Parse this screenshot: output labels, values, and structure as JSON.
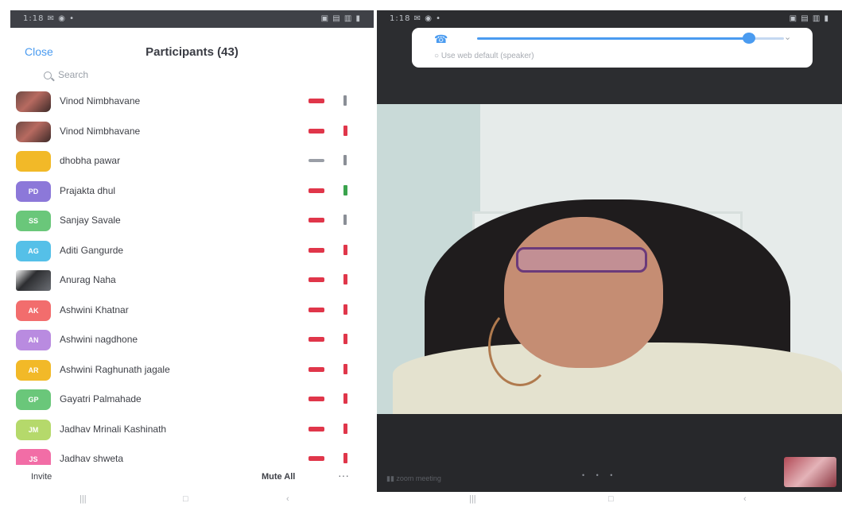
{
  "left_phone": {
    "status_left": "1:18 ✉ ◉ •",
    "status_right": "▣ ▤ ▥ ▮",
    "header": {
      "close_label": "Close",
      "title": "Participants (43)"
    },
    "search": {
      "placeholder": "Search"
    },
    "participants": [
      {
        "initials": "",
        "avatar_color": "photo",
        "name": "Vinod Nimbhavane",
        "sub": "",
        "mic": "muted",
        "cam": "grey"
      },
      {
        "initials": "",
        "avatar_color": "photo",
        "name": "Vinod Nimbhavane",
        "sub": "",
        "mic": "muted",
        "cam": "red"
      },
      {
        "initials": "",
        "avatar_color": "#f2b928",
        "name": "dhobha pawar",
        "sub": "",
        "mic": "off",
        "cam": "grey"
      },
      {
        "initials": "PD",
        "avatar_color": "#8c78d9",
        "name": "Prajakta dhul",
        "sub": "",
        "mic": "muted",
        "cam": "green"
      },
      {
        "initials": "SS",
        "avatar_color": "#6ac77a",
        "name": "Sanjay Savale",
        "sub": "",
        "mic": "muted",
        "cam": "grey"
      },
      {
        "initials": "AG",
        "avatar_color": "#55c0e8",
        "name": "Aditi Gangurde",
        "sub": "",
        "mic": "muted",
        "cam": "red"
      },
      {
        "initials": "",
        "avatar_color": "photo2",
        "name": "Anurag Naha",
        "sub": "",
        "mic": "muted",
        "cam": "red"
      },
      {
        "initials": "AK",
        "avatar_color": "#f26d6d",
        "name": "Ashwini Khatnar",
        "sub": "",
        "mic": "muted",
        "cam": "red"
      },
      {
        "initials": "AN",
        "avatar_color": "#b98be0",
        "name": "Ashwini nagdhone",
        "sub": "",
        "mic": "muted",
        "cam": "red"
      },
      {
        "initials": "AR",
        "avatar_color": "#f2b928",
        "name": "Ashwini Raghunath jagale",
        "sub": "",
        "mic": "muted",
        "cam": "red"
      },
      {
        "initials": "GP",
        "avatar_color": "#6ac77a",
        "name": "Gayatri Palmahade",
        "sub": "",
        "mic": "muted",
        "cam": "red"
      },
      {
        "initials": "JM",
        "avatar_color": "#b5d96b",
        "name": "Jadhav Mrinali Kashinath",
        "sub": "",
        "mic": "muted",
        "cam": "red"
      },
      {
        "initials": "JS",
        "avatar_color": "#f26da6",
        "name": "Jadhav shweta",
        "sub": "",
        "mic": "muted",
        "cam": "red"
      }
    ],
    "footer": {
      "invite_label": "Invite",
      "mute_all_label": "Mute All",
      "more_label": "···"
    }
  },
  "right_phone": {
    "status_left": "1:18 ✉ ◉ •",
    "status_right": "▣ ▤ ▥ ▮",
    "audio_panel": {
      "phone_glyph": "☎",
      "chevron_glyph": "⌄",
      "text": "○ Use web default (speaker)"
    },
    "meeting_text": "▮▮ zoom meeting",
    "page_dots": "• • •"
  },
  "nav_left": {
    "recent": "|||",
    "home": "□",
    "back": "‹"
  },
  "nav_right": {
    "recent": "|||",
    "home": "□",
    "back": "‹"
  },
  "colors": {
    "accent_blue": "#4a9bf0",
    "muted_red": "#e0364a",
    "video_green": "#3aa34d"
  }
}
